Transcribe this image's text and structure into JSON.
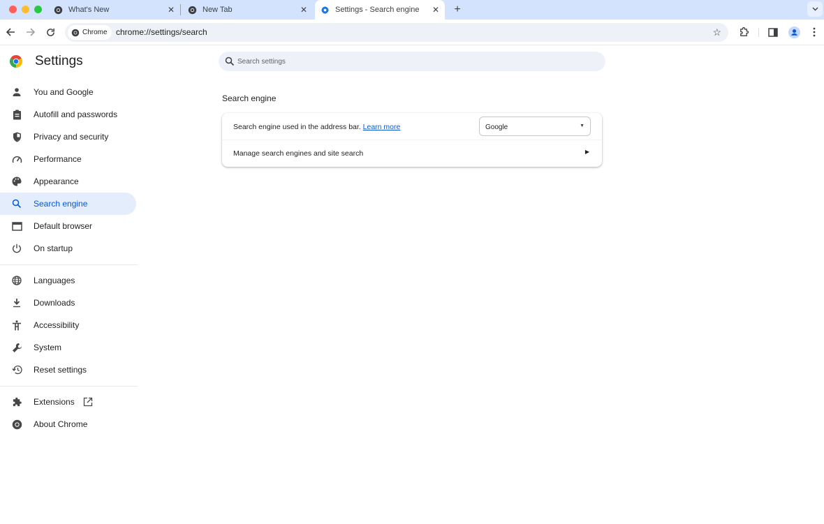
{
  "window": {
    "traffic_lights": [
      "close",
      "minimize",
      "maximize"
    ]
  },
  "tabs": [
    {
      "title": "What's New",
      "icon": "chrome-icon",
      "active": false
    },
    {
      "title": "New Tab",
      "icon": "chrome-icon",
      "active": false
    },
    {
      "title": "Settings - Search engine",
      "icon": "gear-icon",
      "active": true
    }
  ],
  "toolbar": {
    "chip_label": "Chrome",
    "url": "chrome://settings/search",
    "new_tab_symbol": "+",
    "tab_search_symbol": "⌄"
  },
  "settings": {
    "title": "Settings",
    "search_placeholder": "Search settings",
    "search_value": ""
  },
  "sidebar": {
    "items": [
      {
        "label": "You and Google",
        "icon": "person-icon"
      },
      {
        "label": "Autofill and passwords",
        "icon": "clipboard-icon"
      },
      {
        "label": "Privacy and security",
        "icon": "shield-icon"
      },
      {
        "label": "Performance",
        "icon": "speedometer-icon"
      },
      {
        "label": "Appearance",
        "icon": "palette-icon"
      },
      {
        "label": "Search engine",
        "icon": "search-icon",
        "active": true
      },
      {
        "label": "Default browser",
        "icon": "browser-icon"
      },
      {
        "label": "On startup",
        "icon": "power-icon"
      },
      {
        "label": "Languages",
        "icon": "globe-icon"
      },
      {
        "label": "Downloads",
        "icon": "download-icon"
      },
      {
        "label": "Accessibility",
        "icon": "accessibility-icon"
      },
      {
        "label": "System",
        "icon": "wrench-icon"
      },
      {
        "label": "Reset settings",
        "icon": "history-icon"
      },
      {
        "label": "Extensions",
        "icon": "puzzle-icon"
      },
      {
        "label": "About Chrome",
        "icon": "chrome-icon"
      }
    ]
  },
  "main": {
    "section_title": "Search engine",
    "address_bar_text": "Search engine used in the address bar.",
    "learn_more": "Learn more",
    "selected_engine": "Google",
    "manage_label": "Manage search engines and site search"
  },
  "colors": {
    "accent": "#0b57d0",
    "active_nav_bg": "#e3edfb",
    "tabstrip_bg": "#d3e3fd"
  }
}
